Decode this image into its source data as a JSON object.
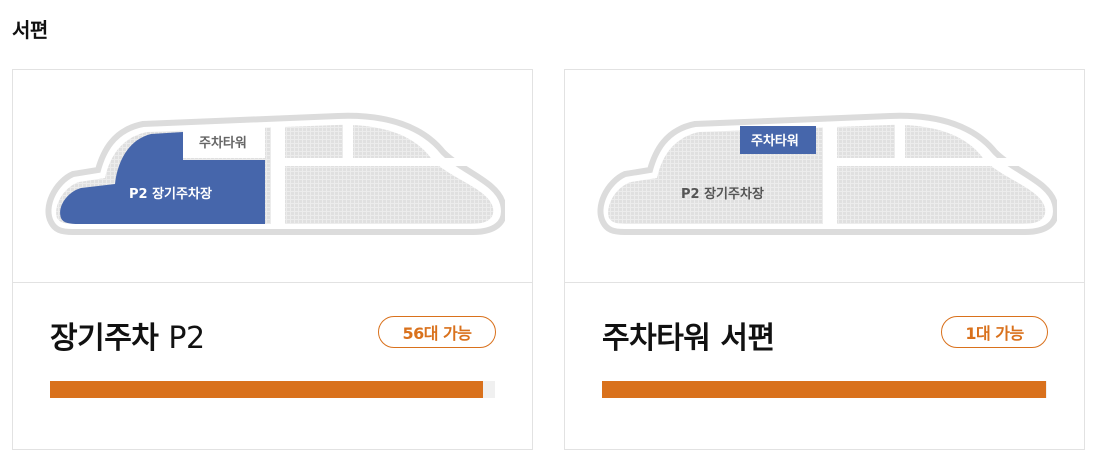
{
  "section_title": "서편",
  "colors": {
    "accent": "#d9711c",
    "highlight": "#4666ab",
    "map_base": "#e6e6e6",
    "map_outline": "#d5d5d5"
  },
  "cards": [
    {
      "map_labels": {
        "tower": "주차타워",
        "lot": "P2 장기주차장"
      },
      "highlighted_zone": "lot",
      "name_main": "장기주차",
      "name_suffix": "P2",
      "availability": "56대 가능",
      "progress_fraction": 0.973
    },
    {
      "map_labels": {
        "tower": "주차타워",
        "lot": "P2 장기주차장"
      },
      "highlighted_zone": "tower",
      "name_main": "주차타워 서편",
      "name_suffix": "",
      "availability": "1대 가능",
      "progress_fraction": 0.998
    }
  ]
}
